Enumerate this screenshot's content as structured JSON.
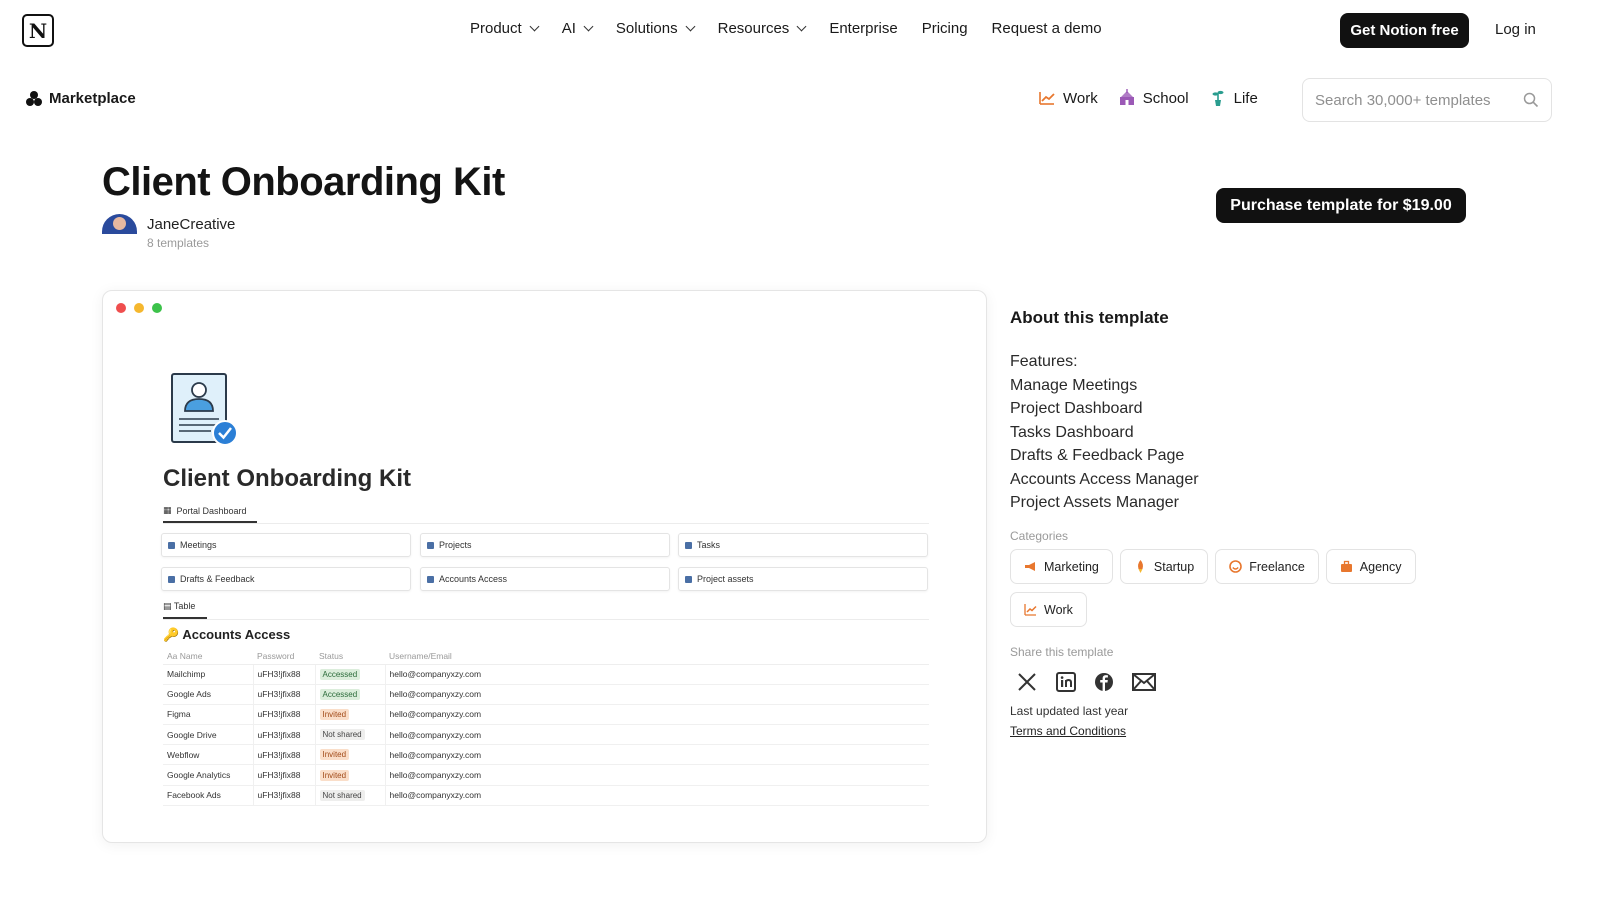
{
  "nav": {
    "logo_letter": "N",
    "links": [
      {
        "label": "Product",
        "dropdown": true
      },
      {
        "label": "AI",
        "dropdown": true
      },
      {
        "label": "Solutions",
        "dropdown": true
      },
      {
        "label": "Resources",
        "dropdown": true
      },
      {
        "label": "Enterprise",
        "dropdown": false
      },
      {
        "label": "Pricing",
        "dropdown": false
      },
      {
        "label": "Request a demo",
        "dropdown": false
      }
    ],
    "cta": "Get Notion free",
    "login": "Log in"
  },
  "marketplace": {
    "label": "Marketplace",
    "tabs": [
      {
        "label": "Work",
        "icon": "chart-icon",
        "color": "#e8772e"
      },
      {
        "label": "School",
        "icon": "school-icon",
        "color": "#9b59b6"
      },
      {
        "label": "Life",
        "icon": "plant-icon",
        "color": "#2a9d8f"
      }
    ],
    "search_placeholder": "Search 30,000+ templates"
  },
  "template": {
    "title": "Client Onboarding Kit",
    "author": "JaneCreative",
    "author_templates": "8 templates",
    "purchase_label": "Purchase template for $19.00"
  },
  "preview": {
    "title": "Client Onboarding Kit",
    "tab_label": "Portal Dashboard",
    "tiles": [
      "Meetings",
      "Projects",
      "Tasks",
      "Drafts & Feedback",
      "Accounts Access",
      "Project assets"
    ],
    "table_tab": "Table",
    "table_title": "Accounts Access",
    "columns": [
      "Aa Name",
      "Password",
      "Status",
      "Username/Email"
    ],
    "rows": [
      {
        "name": "Mailchimp",
        "password": "uFH3!jfix88",
        "status": "Accessed",
        "email": "hello@companyxzy.com"
      },
      {
        "name": "Google Ads",
        "password": "uFH3!jfix88",
        "status": "Accessed",
        "email": "hello@companyxzy.com"
      },
      {
        "name": "Figma",
        "password": "uFH3!jfix88",
        "status": "Invited",
        "email": "hello@companyxzy.com"
      },
      {
        "name": "Google Drive",
        "password": "uFH3!jfix88",
        "status": "Not shared",
        "email": "hello@companyxzy.com"
      },
      {
        "name": "Webflow",
        "password": "uFH3!jfix88",
        "status": "Invited",
        "email": "hello@companyxzy.com"
      },
      {
        "name": "Google Analytics",
        "password": "uFH3!jfix88",
        "status": "Invited",
        "email": "hello@companyxzy.com"
      },
      {
        "name": "Facebook Ads",
        "password": "uFH3!jfix88",
        "status": "Not shared",
        "email": "hello@companyxzy.com"
      }
    ],
    "status_colors": {
      "Accessed": {
        "bg": "#dbeddb",
        "fg": "#2b6b3a"
      },
      "Invited": {
        "bg": "#fadec9",
        "fg": "#a14a18"
      },
      "Not shared": {
        "bg": "#eeeeed",
        "fg": "#444444"
      }
    }
  },
  "about": {
    "heading": "About this template",
    "features_label": "Features:",
    "features": [
      "Manage Meetings",
      "Project Dashboard",
      "Tasks Dashboard",
      "Drafts & Feedback Page",
      "Accounts Access Manager",
      "Project Assets Manager"
    ],
    "categories_label": "Categories",
    "categories": [
      {
        "label": "Marketing",
        "icon": "megaphone-icon",
        "color": "#e8772e"
      },
      {
        "label": "Startup",
        "icon": "rocket-icon",
        "color": "#e8772e"
      },
      {
        "label": "Freelance",
        "icon": "smile-icon",
        "color": "#e8772e"
      },
      {
        "label": "Agency",
        "icon": "briefcase-icon",
        "color": "#e8772e"
      },
      {
        "label": "Work",
        "icon": "chart-icon",
        "color": "#e8772e"
      }
    ],
    "share_label": "Share this template",
    "updated": "Last updated last year",
    "terms": "Terms and Conditions"
  }
}
